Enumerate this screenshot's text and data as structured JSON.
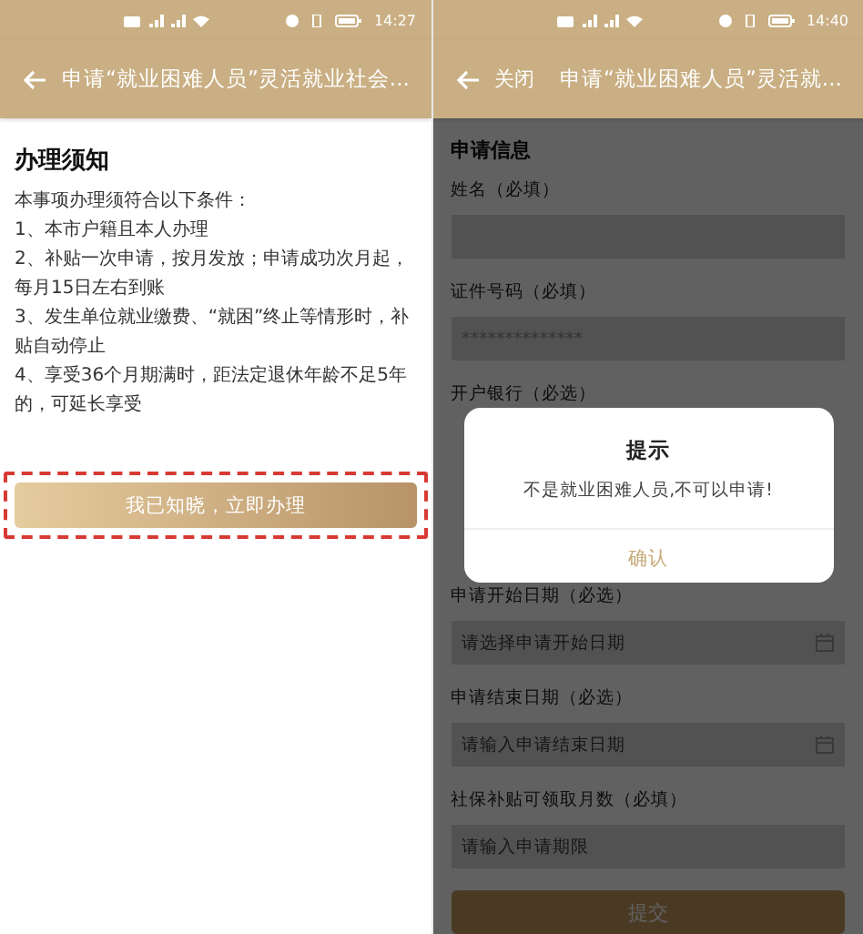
{
  "screens": [
    {
      "status_bar": {
        "time": "14:27"
      },
      "nav": {
        "title": "申请“就业困难人员”灵活就业社会..."
      },
      "notice": {
        "heading": "办理须知",
        "lines": [
          "本事项办理须符合以下条件：",
          "1、本市户籍且本人办理",
          "2、补贴一次申请，按月发放；申请成功次月起，每月15日左右到账",
          "3、发生单位就业缴费、“就困”终止等情形时，补贴自动停止",
          "4、享受36个月期满时，距法定退休年龄不足5年的，可延长享受"
        ],
        "button": {
          "label": "我已知晓，立即办理",
          "highlighted": true
        }
      }
    },
    {
      "status_bar": {
        "time": "14:40"
      },
      "nav": {
        "close": "关闭",
        "title": "申请“就业困难人员”灵活就..."
      },
      "form": {
        "heading": "申请信息",
        "fields": [
          {
            "kind": "text",
            "label": "姓名（必填）"
          },
          {
            "kind": "text",
            "label": "证件号码（必填）",
            "value": "**************"
          },
          {
            "kind": "covered",
            "label": "开户银行（必选）"
          },
          {
            "kind": "date",
            "label": "申请开始日期（必选）",
            "placeholder": "请选择申请开始日期"
          },
          {
            "kind": "date",
            "label": "申请结束日期（必选）",
            "placeholder": "请输入申请结束日期"
          },
          {
            "kind": "text",
            "label": "社保补贴可领取月数（必填）",
            "placeholder": "请输入申请期限"
          }
        ],
        "submit": "提交"
      },
      "dialog": {
        "title": "提示",
        "message": "不是就业困难人员,不可以申请!",
        "confirm": "确认"
      }
    }
  ]
}
